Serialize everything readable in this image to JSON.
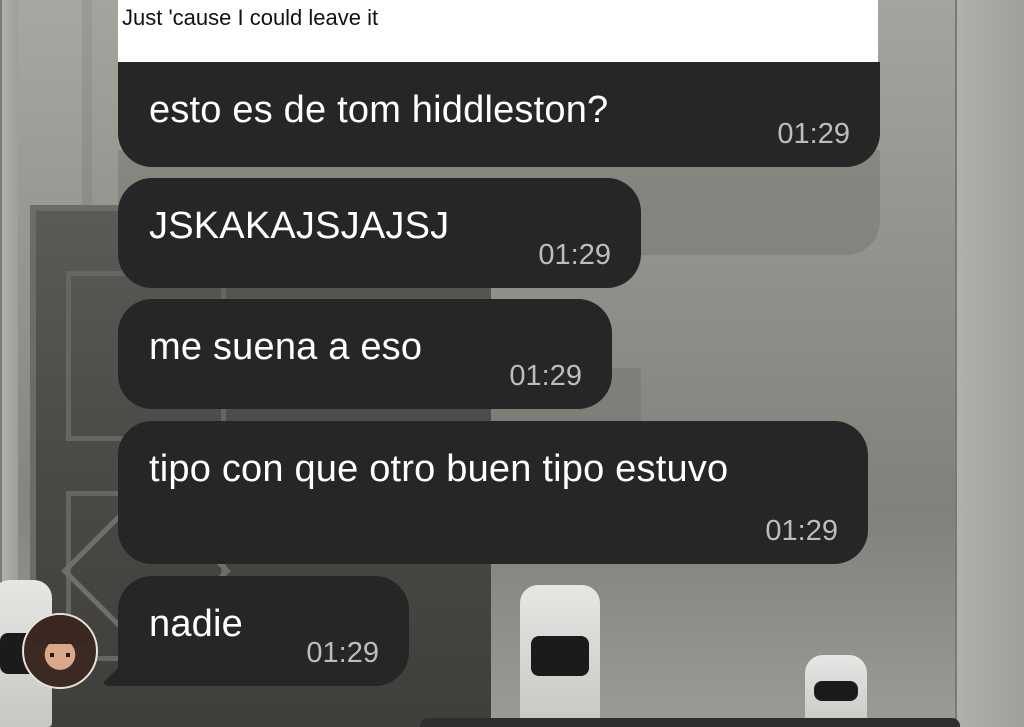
{
  "reply": {
    "text": "Just 'cause I could leave it"
  },
  "messages": [
    {
      "text": "esto es de tom hiddleston?",
      "time": "01:29"
    },
    {
      "text": "JSKAKAJSJAJSJ",
      "time": "01:29"
    },
    {
      "text": "me suena a eso",
      "time": "01:29"
    },
    {
      "text": "tipo con que otro buen tipo estuvo",
      "time": "01:29"
    },
    {
      "text": "nadie",
      "time": "01:29"
    }
  ],
  "avatar": {
    "icon": "user-avatar-photo"
  },
  "colors": {
    "bubble": "#262626",
    "bubble_text": "#ffffff",
    "timestamp": "#bdbdbd",
    "reply_bg": "#ffffff"
  }
}
